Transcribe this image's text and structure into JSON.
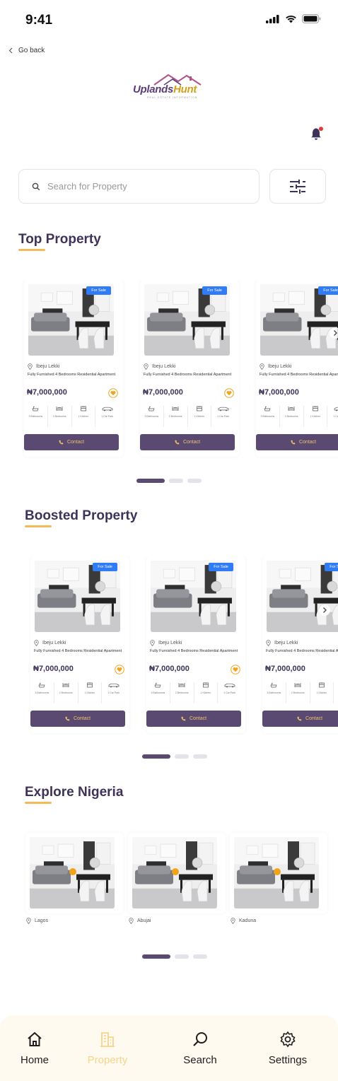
{
  "status_bar": {
    "time": "9:41"
  },
  "header": {
    "back_label": "Go back",
    "logo": {
      "part1": "Uplands",
      "part2": "Hunt",
      "tagline": "REAL ESTATE INFORMATION"
    }
  },
  "search": {
    "placeholder": "Search for Property"
  },
  "sections": {
    "top": {
      "title": "Top Property"
    },
    "boosted": {
      "title": "Boosted Property"
    },
    "explore": {
      "title": "Explore Nigeria"
    }
  },
  "listing": {
    "badge": "For Sale",
    "location": "Ibeju Lekki",
    "title": "Fully Furnished 4 Bedrooms Residential Apartment",
    "price": "₦7,000,000",
    "amenities": [
      "3 Bathrooms",
      "2 Bedrooms",
      "1 Kitchen",
      "1 Car Park"
    ],
    "contact_label": "Contact"
  },
  "explore_cities": [
    "Lagos",
    "Abujai",
    "Kaduna"
  ],
  "bottom_nav": {
    "home": "Home",
    "property": "Property",
    "search": "Search",
    "settings": "Settings"
  },
  "colors": {
    "brand_purple": "#5a4a72",
    "accent_orange": "#f0a31b",
    "badge_blue": "#2f7cf6",
    "underline": "#f5b95a",
    "notification_dot": "#e23b3b"
  }
}
